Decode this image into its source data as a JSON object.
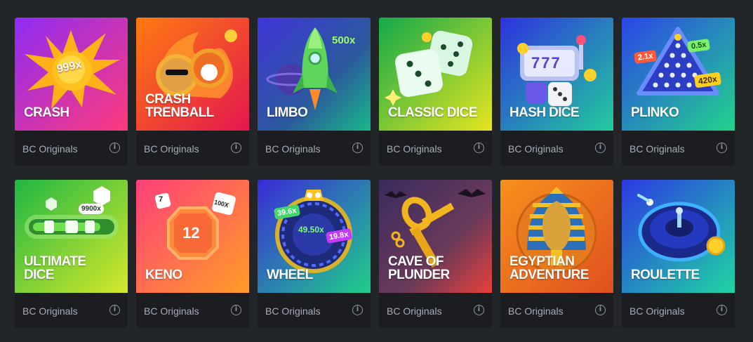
{
  "games": [
    {
      "title": "CRASH",
      "provider": "BC Originals",
      "art_text": "999x",
      "icon": "explosion-icon",
      "bg": [
        "#9b2cf2",
        "#ff3f8e"
      ]
    },
    {
      "title": "CRASH\nTRENBALL",
      "provider": "BC Originals",
      "art_text": "",
      "icon": "doge-shiba-coins-icon",
      "bg": [
        "#ff6a1a",
        "#e6245a"
      ]
    },
    {
      "title": "LIMBO",
      "provider": "BC Originals",
      "art_text": "500x",
      "icon": "rocket-icon",
      "bg": [
        "#4a3bd8",
        "#19b88b"
      ]
    },
    {
      "title": "CLASSIC DICE",
      "provider": "BC Originals",
      "art_text": "",
      "icon": "dice-icon",
      "bg": [
        "#1fb24a",
        "#e9e21d"
      ]
    },
    {
      "title": "HASH DICE",
      "provider": "BC Originals",
      "art_text": "777",
      "icon": "slot-machine-icon",
      "bg": [
        "#2a3de6",
        "#21c9a0"
      ]
    },
    {
      "title": "PLINKO",
      "provider": "BC Originals",
      "art_text": "",
      "icon": "plinko-triangle-icon",
      "bg": [
        "#2a46e8",
        "#24d38e"
      ],
      "badges": [
        "2.1x",
        "0.5x",
        "420x"
      ]
    },
    {
      "title": "ULTIMATE\nDICE",
      "provider": "BC Originals",
      "art_text": "9900x",
      "icon": "slider-dice-icon",
      "bg": [
        "#28c045",
        "#cfe52a"
      ]
    },
    {
      "title": "KENO",
      "provider": "BC Originals",
      "art_text": "12",
      "icon": "keno-gem-icon",
      "bg": [
        "#ff4e7b",
        "#ff9c2a"
      ],
      "badges": [
        "7",
        "100X"
      ]
    },
    {
      "title": "WHEEL",
      "provider": "BC Originals",
      "art_text": "49.50x",
      "icon": "wheel-icon",
      "bg": [
        "#3b2ad8",
        "#1fcf8a"
      ],
      "badges": [
        "39.6x",
        "19.8x"
      ]
    },
    {
      "title": "CAVE OF\nPLUNDER",
      "provider": "BC Originals",
      "art_text": "",
      "icon": "ankh-treasure-icon",
      "bg": [
        "#3a2c6e",
        "#e8443a"
      ]
    },
    {
      "title": "EGYPTIAN\nADVENTURE",
      "provider": "BC Originals",
      "art_text": "",
      "icon": "pharaoh-icon",
      "bg": [
        "#f58a1c",
        "#e0531f"
      ]
    },
    {
      "title": "ROULETTE",
      "provider": "BC Originals",
      "art_text": "",
      "icon": "roulette-icon",
      "bg": [
        "#2d3ae3",
        "#1fd4a3"
      ]
    }
  ],
  "info_glyph": "i"
}
